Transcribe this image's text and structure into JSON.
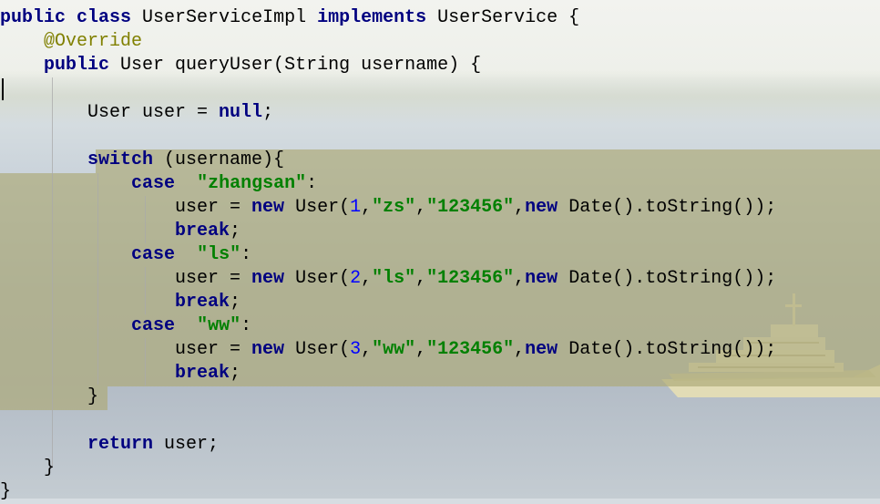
{
  "editor": {
    "lines": [
      [
        {
          "t": "kw",
          "v": "public"
        },
        {
          "t": "pl",
          "v": " "
        },
        {
          "t": "kw",
          "v": "class"
        },
        {
          "t": "pl",
          "v": " UserServiceImpl "
        },
        {
          "t": "kw",
          "v": "implements"
        },
        {
          "t": "pl",
          "v": " UserService {"
        }
      ],
      [
        {
          "t": "pl",
          "v": "    "
        },
        {
          "t": "ann",
          "v": "@Override"
        }
      ],
      [
        {
          "t": "pl",
          "v": "    "
        },
        {
          "t": "kw",
          "v": "public"
        },
        {
          "t": "pl",
          "v": " User queryUser(String username) {"
        }
      ],
      [
        {
          "t": "pl",
          "v": ""
        }
      ],
      [
        {
          "t": "pl",
          "v": "        User user = "
        },
        {
          "t": "kw",
          "v": "null"
        },
        {
          "t": "pl",
          "v": ";"
        }
      ],
      [
        {
          "t": "pl",
          "v": ""
        }
      ],
      [
        {
          "t": "pl",
          "v": "        "
        },
        {
          "t": "kw",
          "v": "switch"
        },
        {
          "t": "pl",
          "v": " (username){"
        }
      ],
      [
        {
          "t": "pl",
          "v": "            "
        },
        {
          "t": "kw",
          "v": "case"
        },
        {
          "t": "pl",
          "v": "  "
        },
        {
          "t": "str",
          "v": "\"zhangsan\""
        },
        {
          "t": "pl",
          "v": ":"
        }
      ],
      [
        {
          "t": "pl",
          "v": "                user = "
        },
        {
          "t": "kw",
          "v": "new"
        },
        {
          "t": "pl",
          "v": " User("
        },
        {
          "t": "num",
          "v": "1"
        },
        {
          "t": "pl",
          "v": ","
        },
        {
          "t": "str",
          "v": "\"zs\""
        },
        {
          "t": "pl",
          "v": ","
        },
        {
          "t": "str",
          "v": "\"123456\""
        },
        {
          "t": "pl",
          "v": ","
        },
        {
          "t": "kw",
          "v": "new"
        },
        {
          "t": "pl",
          "v": " Date().toString());"
        }
      ],
      [
        {
          "t": "pl",
          "v": "                "
        },
        {
          "t": "kw",
          "v": "break"
        },
        {
          "t": "pl",
          "v": ";"
        }
      ],
      [
        {
          "t": "pl",
          "v": "            "
        },
        {
          "t": "kw",
          "v": "case"
        },
        {
          "t": "pl",
          "v": "  "
        },
        {
          "t": "str",
          "v": "\"ls\""
        },
        {
          "t": "pl",
          "v": ":"
        }
      ],
      [
        {
          "t": "pl",
          "v": "                user = "
        },
        {
          "t": "kw",
          "v": "new"
        },
        {
          "t": "pl",
          "v": " User("
        },
        {
          "t": "num",
          "v": "2"
        },
        {
          "t": "pl",
          "v": ","
        },
        {
          "t": "str",
          "v": "\"ls\""
        },
        {
          "t": "pl",
          "v": ","
        },
        {
          "t": "str",
          "v": "\"123456\""
        },
        {
          "t": "pl",
          "v": ","
        },
        {
          "t": "kw",
          "v": "new"
        },
        {
          "t": "pl",
          "v": " Date().toString());"
        }
      ],
      [
        {
          "t": "pl",
          "v": "                "
        },
        {
          "t": "kw",
          "v": "break"
        },
        {
          "t": "pl",
          "v": ";"
        }
      ],
      [
        {
          "t": "pl",
          "v": "            "
        },
        {
          "t": "kw",
          "v": "case"
        },
        {
          "t": "pl",
          "v": "  "
        },
        {
          "t": "str",
          "v": "\"ww\""
        },
        {
          "t": "pl",
          "v": ":"
        }
      ],
      [
        {
          "t": "pl",
          "v": "                user = "
        },
        {
          "t": "kw",
          "v": "new"
        },
        {
          "t": "pl",
          "v": " User("
        },
        {
          "t": "num",
          "v": "3"
        },
        {
          "t": "pl",
          "v": ","
        },
        {
          "t": "str",
          "v": "\"ww\""
        },
        {
          "t": "pl",
          "v": ","
        },
        {
          "t": "str",
          "v": "\"123456\""
        },
        {
          "t": "pl",
          "v": ","
        },
        {
          "t": "kw",
          "v": "new"
        },
        {
          "t": "pl",
          "v": " Date().toString());"
        }
      ],
      [
        {
          "t": "pl",
          "v": "                "
        },
        {
          "t": "kw",
          "v": "break"
        },
        {
          "t": "pl",
          "v": ";"
        }
      ],
      [
        {
          "t": "pl",
          "v": "        }"
        }
      ],
      [
        {
          "t": "pl",
          "v": ""
        }
      ],
      [
        {
          "t": "pl",
          "v": "        "
        },
        {
          "t": "kw",
          "v": "return"
        },
        {
          "t": "pl",
          "v": " user;"
        }
      ],
      [
        {
          "t": "pl",
          "v": "    }"
        }
      ],
      [
        {
          "t": "pl",
          "v": "}"
        }
      ]
    ]
  },
  "colors": {
    "keyword": "#000080",
    "string": "#008000",
    "number": "#0000ff",
    "annotation": "#808000",
    "plain": "#000000",
    "selection": "#adaa78"
  }
}
